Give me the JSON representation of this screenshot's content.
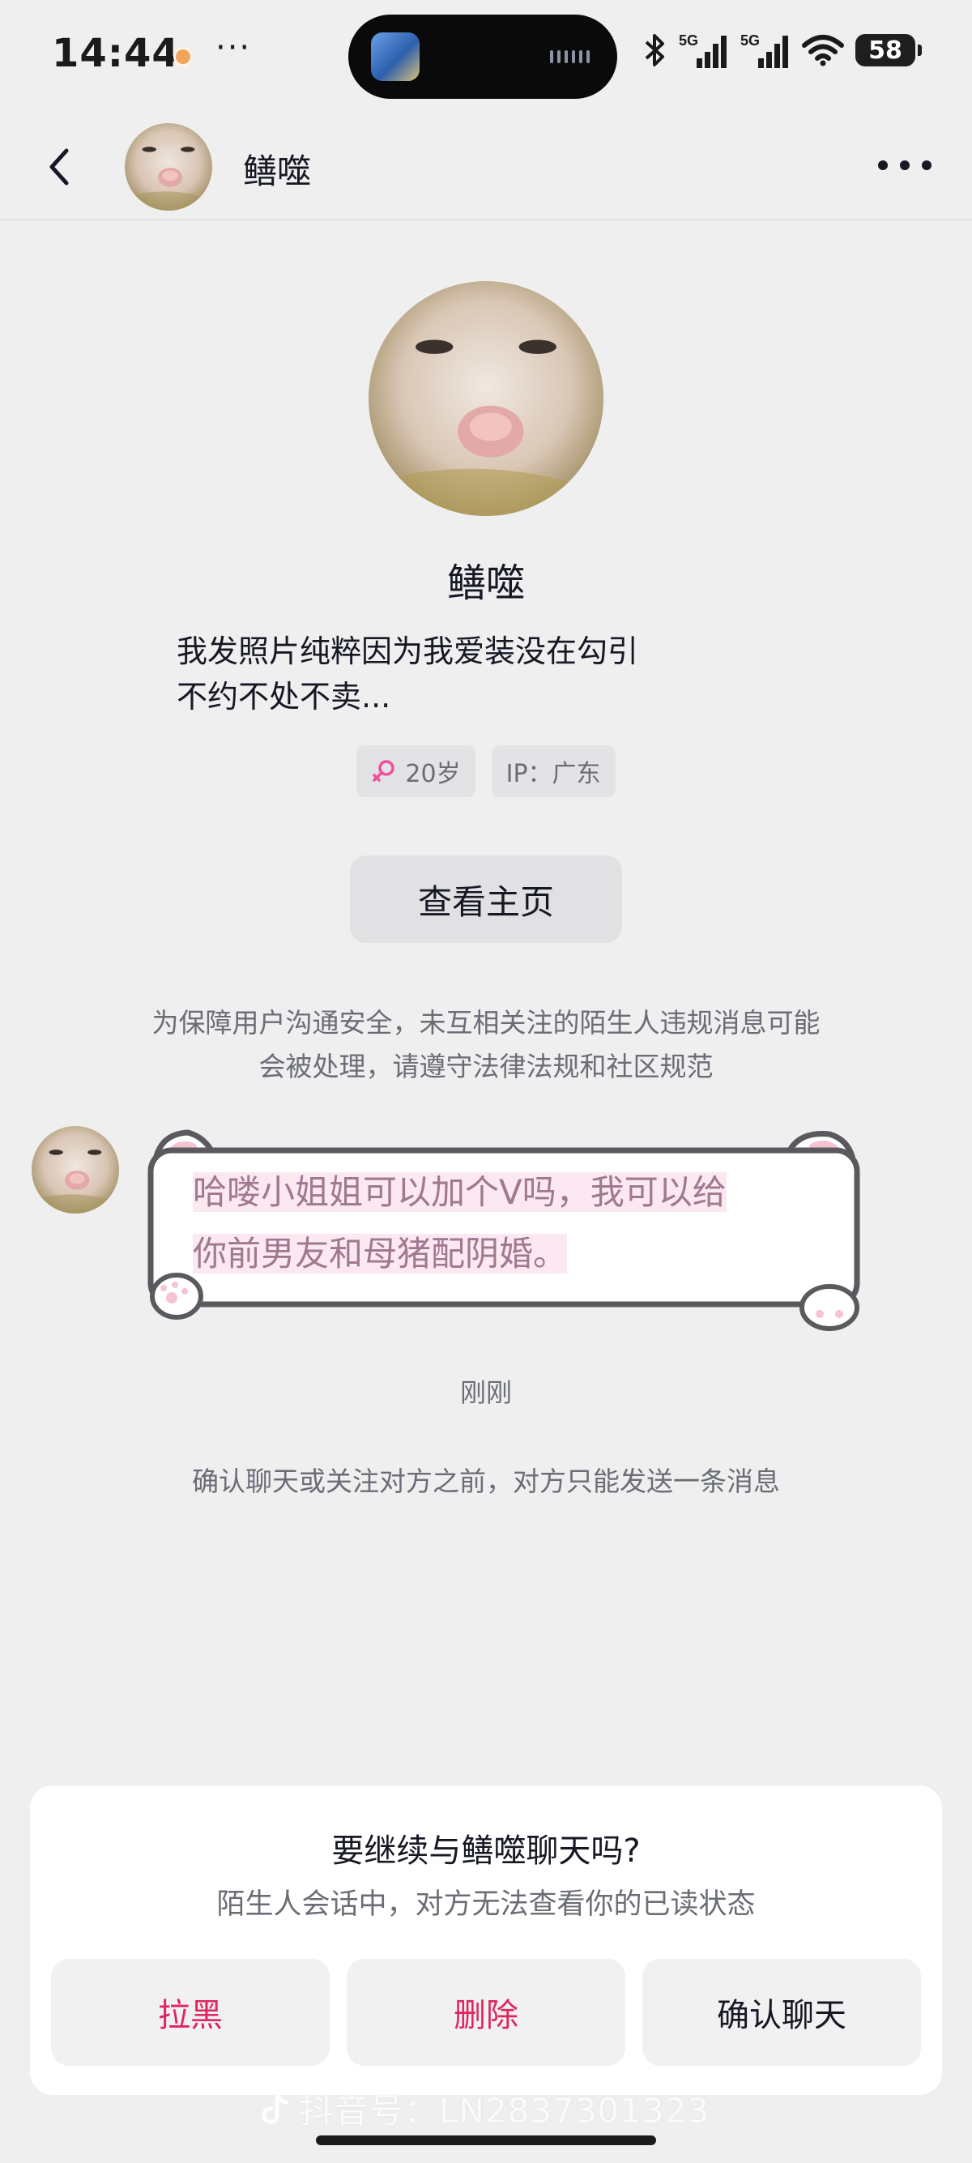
{
  "status_bar": {
    "time": "14:44",
    "more": "···",
    "battery": "58",
    "network_1": "5G",
    "network_2": "5G",
    "icons": [
      "bluetooth-icon",
      "signal-icon",
      "signal-icon",
      "wifi-icon",
      "battery-icon"
    ]
  },
  "header": {
    "name": "鳝噬",
    "back_icon": "chevron-left-icon",
    "more_icon": "more-horizontal-icon"
  },
  "profile": {
    "name": "鳝噬",
    "bio_line1": "我发照片纯粹因为我爱装没在勾引",
    "bio_line2": "不约不处不卖...",
    "age_tag": "20岁",
    "ip_tag": "IP：广东",
    "view_home": "查看主页"
  },
  "notice": {
    "line1": "为保障用户沟通安全，未互相关注的陌生人违规消息可能",
    "line2": "会被处理，请遵守法律法规和社区规范"
  },
  "message": {
    "line1": "哈喽小姐姐可以加个V吗，我可以给",
    "line2": "你前男友和母猪配阴婚。",
    "time": "刚刚"
  },
  "limit_note": "确认聊天或关注对方之前，对方只能发送一条消息",
  "card": {
    "title": "要继续与鳝噬聊天吗?",
    "subtitle": "陌生人会话中，对方无法查看你的已读状态",
    "block": "拉黑",
    "delete": "删除",
    "confirm": "确认聊天"
  },
  "watermark": "抖音号：LN2837301323",
  "colors": {
    "accent_red": "#e0245e",
    "background": "#efeff0",
    "bubble_text": "#a07890",
    "female_symbol": "#f0509a"
  }
}
